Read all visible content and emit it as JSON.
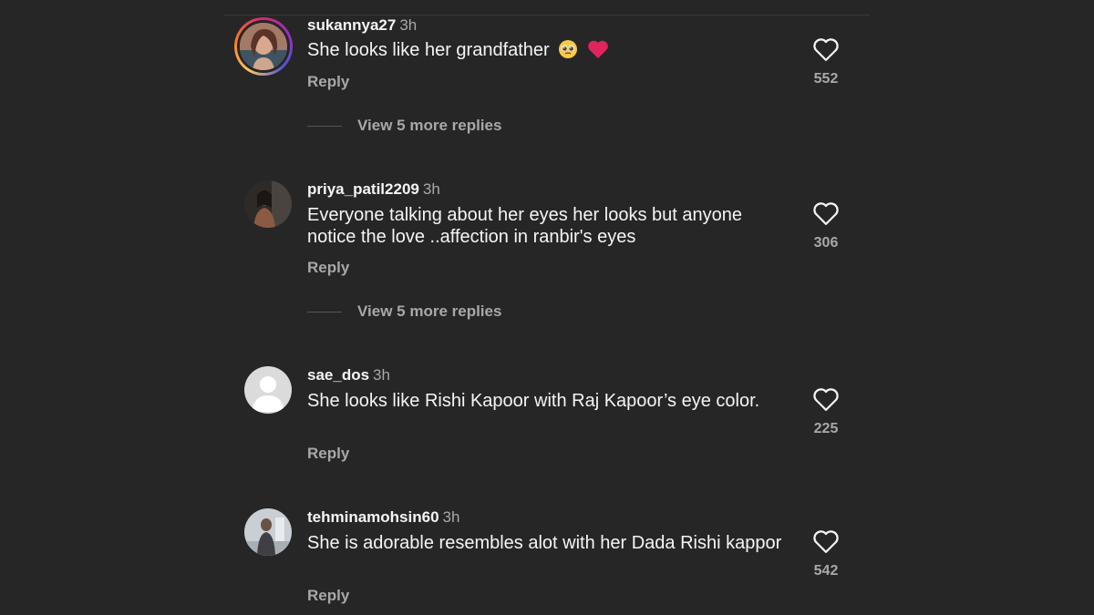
{
  "comments": [
    {
      "username": "sukannya27",
      "time": "3h",
      "text": "She looks like her grandfather",
      "emojis": [
        "pleading-face",
        "red-heart"
      ],
      "reply_label": "Reply",
      "likes": "552",
      "view_replies": "View 5 more replies",
      "avatar": "photo-avatar-with-story-ring"
    },
    {
      "username": "priya_patil2209",
      "time": "3h",
      "text": "Everyone talking about her eyes her looks but anyone notice  the love ..affection in ranbir's eyes",
      "reply_label": "Reply",
      "likes": "306",
      "view_replies": "View 5 more replies",
      "avatar": "photo-avatar"
    },
    {
      "username": "sae_dos",
      "time": "3h",
      "text": "She looks like Rishi Kapoor with Raj Kapoor’s eye color.",
      "reply_label": "Reply",
      "likes": "225",
      "avatar": "default-avatar"
    },
    {
      "username": "tehminamohsin60",
      "time": "3h",
      "text": "She is adorable resembles alot with her Dada Rishi kappor",
      "reply_label": "Reply",
      "likes": "542",
      "avatar": "photo-avatar"
    }
  ],
  "icons": {
    "like": "heart-outline-icon"
  },
  "colors": {
    "background": "#262626",
    "primary_text": "#f5f5f5",
    "secondary_text": "#a8a8a8",
    "heart_emoji": "#e0245e"
  }
}
